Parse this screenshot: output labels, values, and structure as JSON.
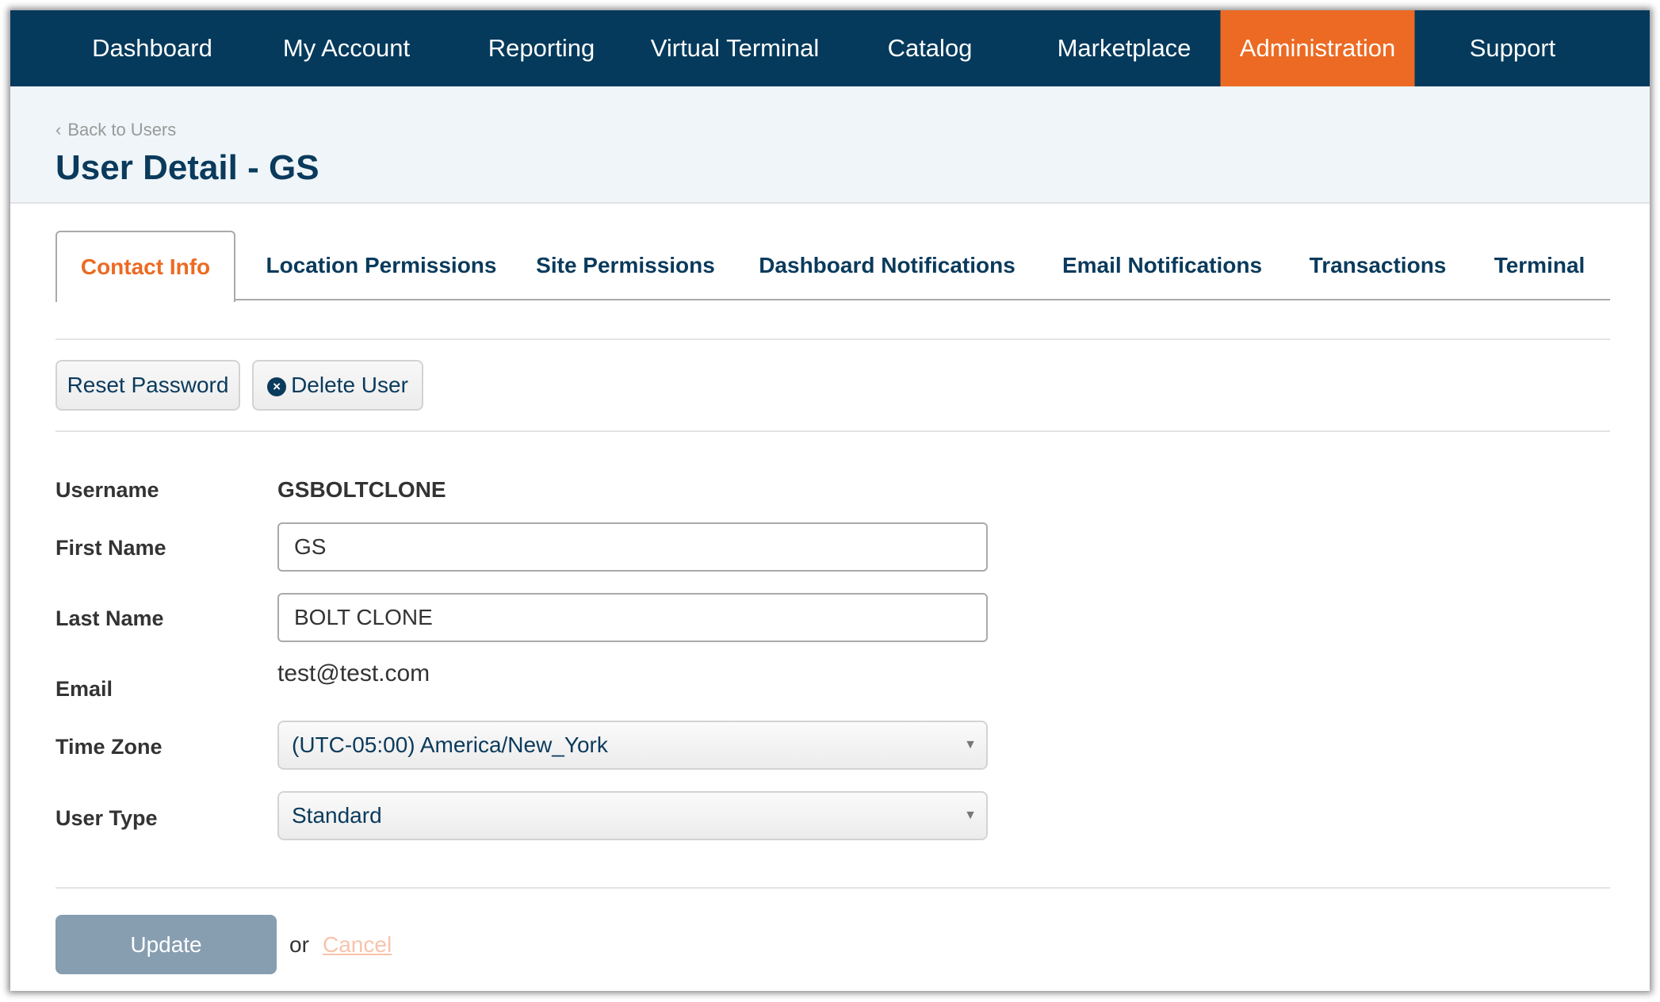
{
  "nav": {
    "items": [
      {
        "label": "Dashboard"
      },
      {
        "label": "My Account"
      },
      {
        "label": "Reporting"
      },
      {
        "label": "Virtual Terminal"
      },
      {
        "label": "Catalog"
      },
      {
        "label": "Marketplace"
      },
      {
        "label": "Administration",
        "active": true
      },
      {
        "label": "Support"
      }
    ],
    "accent": "#ec6a23",
    "background": "#053a5c"
  },
  "header": {
    "back_label": "Back to Users",
    "title": "User Detail - GS"
  },
  "tabs": [
    {
      "label": "Contact Info",
      "active": true
    },
    {
      "label": "Location Permissions"
    },
    {
      "label": "Site Permissions"
    },
    {
      "label": "Dashboard Notifications"
    },
    {
      "label": "Email Notifications"
    },
    {
      "label": "Transactions"
    },
    {
      "label": "Terminal"
    }
  ],
  "actions": {
    "reset_password": "Reset Password",
    "delete_user": "Delete User"
  },
  "form": {
    "username": {
      "label": "Username",
      "value": "GSBOLTCLONE"
    },
    "first_name": {
      "label": "First Name",
      "value": "GS"
    },
    "last_name": {
      "label": "Last Name",
      "value": "BOLT CLONE"
    },
    "email": {
      "label": "Email",
      "value": "test@test.com"
    },
    "time_zone": {
      "label": "Time Zone",
      "value": "(UTC-05:00) America/New_York"
    },
    "user_type": {
      "label": "User Type",
      "value": "Standard"
    }
  },
  "footer": {
    "update": "Update",
    "or": "or",
    "cancel": "Cancel"
  }
}
